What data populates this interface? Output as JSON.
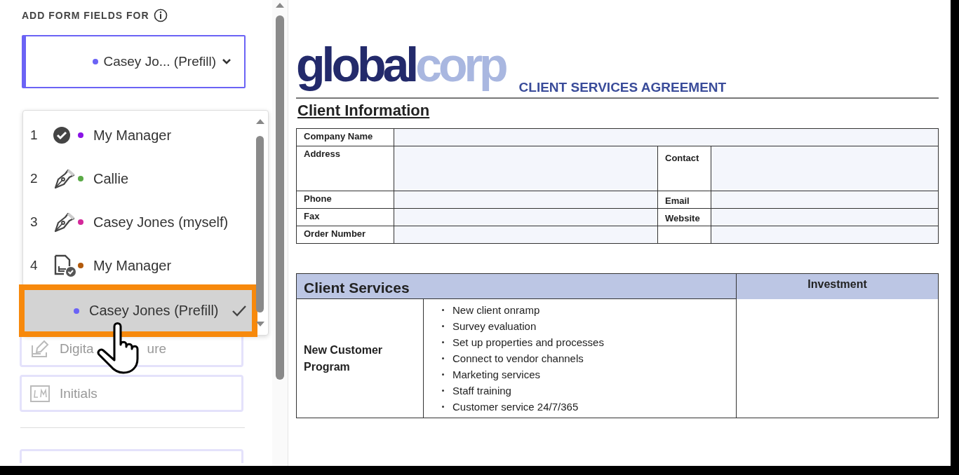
{
  "panel": {
    "heading": "ADD FORM FIELDS FOR",
    "select": {
      "color": "#6b63f5",
      "value": "Casey Jo... (Prefill)"
    },
    "dropdown": [
      {
        "number": "1",
        "kind": "completed",
        "color": "#8a14e6",
        "label": "My Manager",
        "selected": false
      },
      {
        "number": "2",
        "kind": "signer",
        "color": "#5aaa46",
        "label": "Callie",
        "selected": false
      },
      {
        "number": "3",
        "kind": "signer",
        "color": "#d4289a",
        "label": "Casey Jones (myself)",
        "selected": false
      },
      {
        "number": "4",
        "kind": "approver",
        "color": "#b25a0c",
        "label": "My Manager",
        "selected": false
      },
      {
        "kind": "prefill",
        "color": "#6b63f5",
        "label": "Casey Jones (Prefill)",
        "selected": true
      }
    ],
    "fields": [
      {
        "kind": "signature",
        "label": "Digita",
        "label_2": "ure"
      },
      {
        "kind": "initials",
        "label": "Initials"
      }
    ]
  },
  "document": {
    "logo": {
      "part_1": "global",
      "part_2": "corp"
    },
    "title": "CLIENT SERVICES AGREEMENT",
    "section": "Client Information",
    "info_rows": [
      {
        "label": "Company Name"
      },
      {
        "label": "Address",
        "label_2": "Contact"
      },
      {
        "label": "Phone",
        "label_2": "Email"
      },
      {
        "label": "Fax",
        "label_2": "Website"
      },
      {
        "label": "Order Number"
      }
    ],
    "services": {
      "heading": "Client Services",
      "investment": "Investment",
      "program": "New Customer Program",
      "items": [
        "New client onramp",
        "Survey evaluation",
        "Set up properties and processes",
        "Connect to vendor channels",
        "Marketing services",
        "Staff training",
        "Customer service 24/7/365"
      ]
    }
  }
}
